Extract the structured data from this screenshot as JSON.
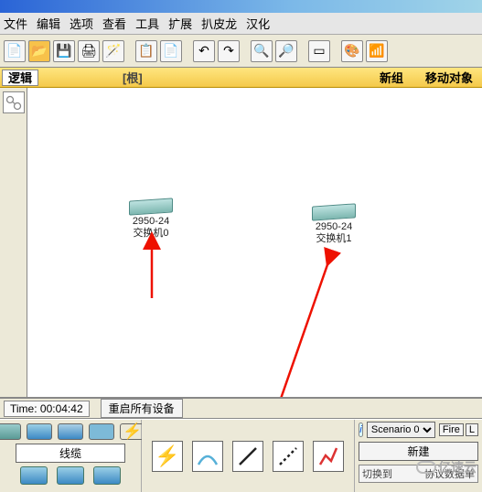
{
  "menu": {
    "file": "文件",
    "edit": "编辑",
    "options": "选项",
    "view": "查看",
    "tools": "工具",
    "extensions": "扩展",
    "pkl": "扒皮龙",
    "hanhua": "汉化"
  },
  "logic": {
    "tab": "逻辑",
    "root": "[根]",
    "new_group": "新组",
    "move_obj": "移动对象"
  },
  "devices": {
    "d0_model": "2950-24",
    "d0_name": "交换机0",
    "d1_model": "2950-24",
    "d1_name": "交换机1"
  },
  "status": {
    "time_label": "Time:",
    "time_value": "00:04:42",
    "restart_all": "重启所有设备"
  },
  "bottom": {
    "category_label": "线缆"
  },
  "scenario": {
    "current": "Scenario 0",
    "fire": "Fire",
    "last": "L",
    "new": "新建",
    "switch_to": "切换到",
    "menu": "协议数据单"
  },
  "watermark": "亿速云"
}
